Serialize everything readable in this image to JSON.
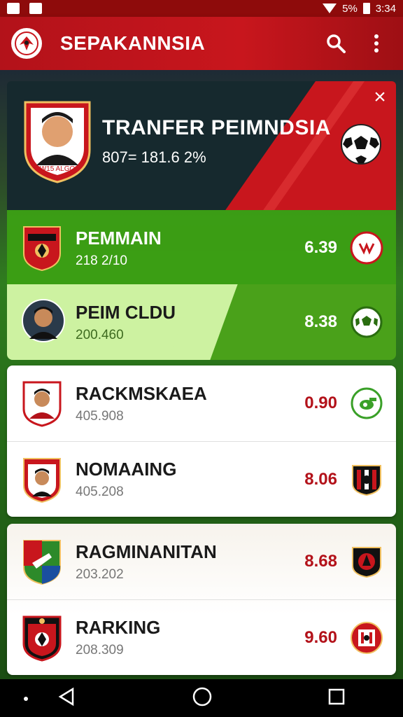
{
  "status_bar": {
    "battery": "5%",
    "time": "3:34"
  },
  "app_bar": {
    "title": "SEPAKANNSIA",
    "icons": [
      "app-logo-icon",
      "search-icon",
      "more-vert-icon"
    ]
  },
  "hero": {
    "title": "TRANFER PEIMNDSIA",
    "subtitle": "807= 181.6 2%",
    "badge_text": "W15 ALGO",
    "icons": [
      "close-icon",
      "soccer-ball-icon"
    ]
  },
  "rows": [
    {
      "name": "PEMMAIN",
      "sub": "218 2/10",
      "score": "6.39",
      "icon": "badge-icon"
    },
    {
      "name": "PEIM CLDU",
      "sub": "200.460",
      "score": "8.38",
      "icon": "soccer-ball-icon"
    },
    {
      "name": "RACKMSKAEA",
      "sub": "405.908",
      "score": "0.90",
      "icon": "whistle-icon"
    },
    {
      "name": "NOMAAING",
      "sub": "405.208",
      "score": "8.06",
      "icon": "club-crest-icon"
    },
    {
      "name": "RAGMINANITAN",
      "sub": "203.202",
      "score": "8.68",
      "icon": "club-crest-icon"
    },
    {
      "name": "RARKING",
      "sub": "208.309",
      "score": "9.60",
      "icon": "club-crest-icon"
    }
  ],
  "colors": {
    "primary_red": "#c8161d",
    "green": "#4aa11a",
    "highlight": "#cdf2a1",
    "score_red": "#b3121a"
  }
}
